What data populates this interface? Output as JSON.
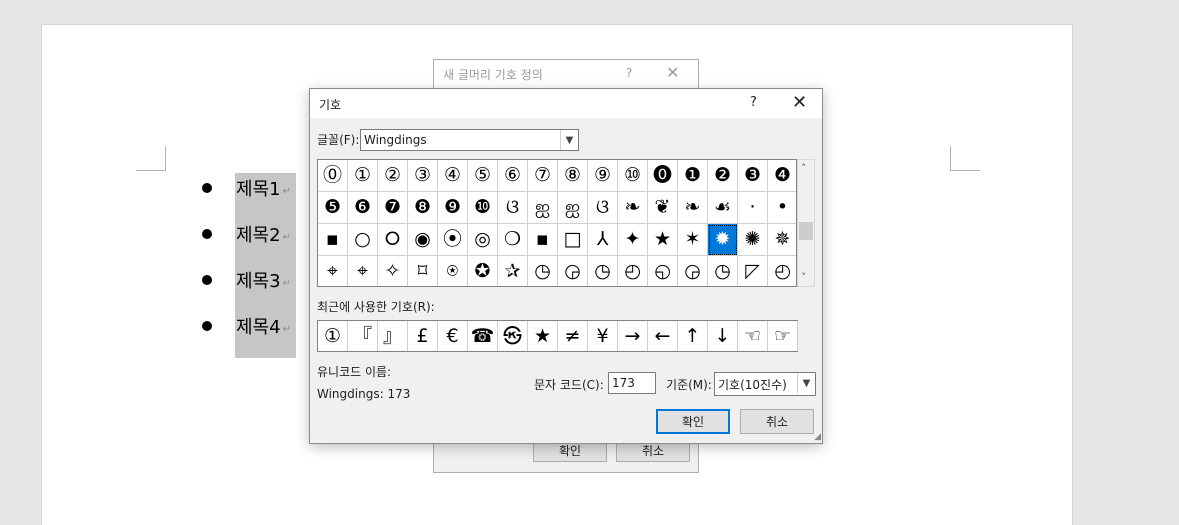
{
  "document": {
    "bullets": [
      "제목1",
      "제목2",
      "제목3",
      "제목4"
    ],
    "para_mark": "↵"
  },
  "back_dialog": {
    "title": "새 글머리 기호 정의",
    "help": "?",
    "close": "✕",
    "ok": "확인",
    "cancel": "취소"
  },
  "dialog": {
    "title": "기호",
    "help": "?",
    "close": "✕",
    "font_label": "글꼴(F):",
    "font_value": "Wingdings",
    "symbols": [
      [
        "⓪",
        "①",
        "②",
        "③",
        "④",
        "⑤",
        "⑥",
        "⑦",
        "⑧",
        "⑨",
        "⑩",
        "⓿",
        "❶",
        "❷",
        "❸",
        "❹"
      ],
      [
        "❺",
        "❻",
        "❼",
        "❽",
        "❾",
        "❿",
        "ଓ",
        "ஐ",
        "ஐ",
        "ଓ",
        "❧",
        "❦",
        "❧",
        "☙",
        "·",
        "•"
      ],
      [
        "▪",
        "○",
        "⭘",
        "◉",
        "⦿",
        "◎",
        "❍",
        "▪",
        "□",
        "⅄",
        "✦",
        "★",
        "✶",
        "✹",
        "✺",
        "✵"
      ],
      [
        "⌖",
        "⌖",
        "✧",
        "⌑",
        "⍟",
        "✪",
        "✰",
        "◷",
        "◶",
        "◷",
        "◴",
        "◵",
        "◶",
        "◷",
        "◸",
        "◴"
      ]
    ],
    "selected_row": 2,
    "selected_col": 13,
    "recent_label": "최근에 사용한 기호(R):",
    "recent": [
      "①",
      "『",
      "』",
      "£",
      "€",
      "☎",
      "㉿",
      "★",
      "≠",
      "¥",
      "→",
      "←",
      "↑",
      "↓",
      "☜",
      "☞"
    ],
    "unicode_name_label": "유니코드 이름:",
    "unicode_name_value": "Wingdings: 173",
    "char_code_label": "문자 코드(C):",
    "char_code_value": "173",
    "base_label": "기준(M):",
    "base_value": "기호(10진수)",
    "ok": "확인",
    "cancel": "취소"
  },
  "colors": {
    "accent": "#0078d7",
    "selection_bg": "#c6c6c6"
  }
}
